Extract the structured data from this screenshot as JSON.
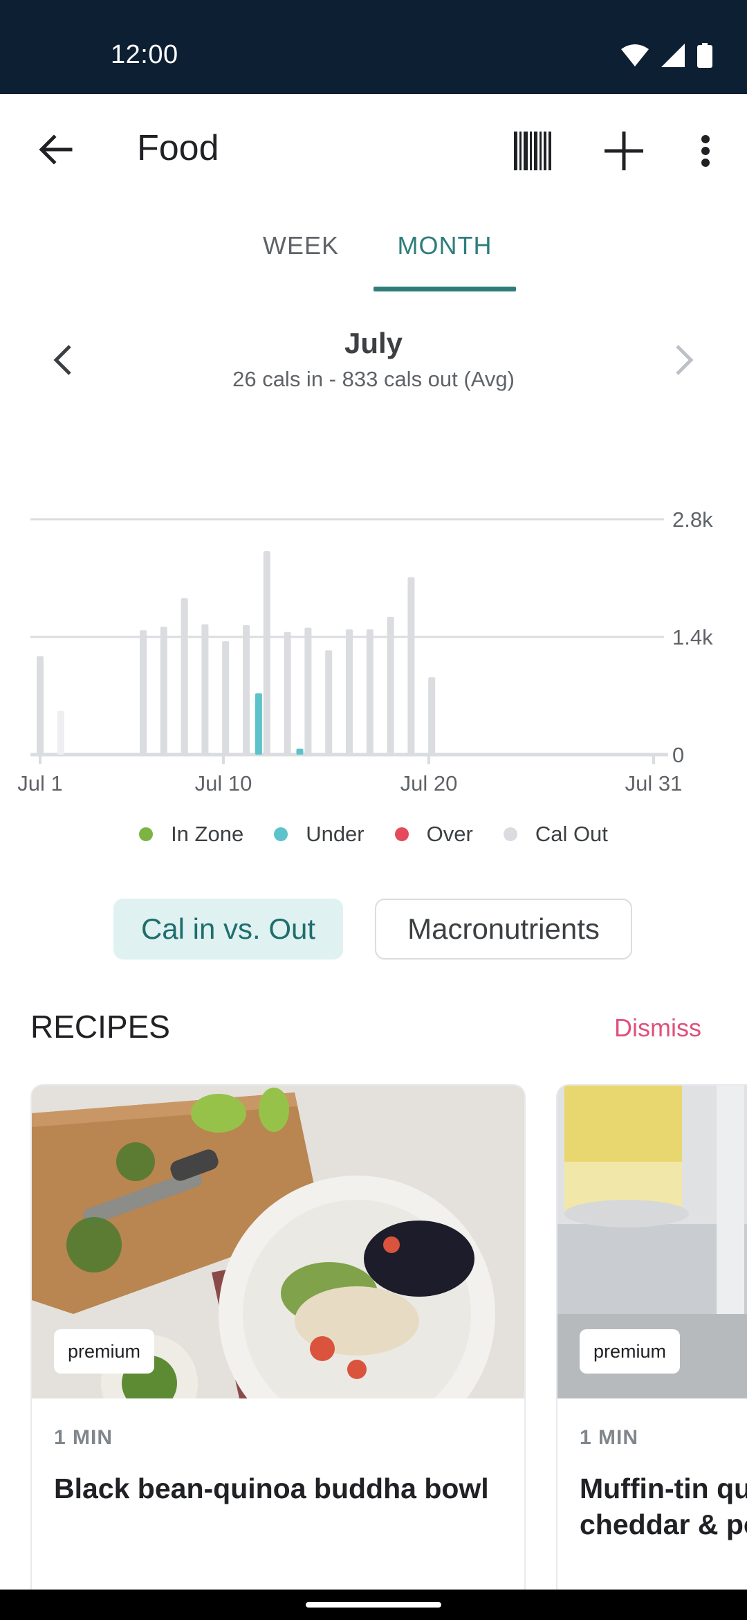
{
  "status_bar": {
    "time": "12:00"
  },
  "app_bar": {
    "title": "Food",
    "icons": [
      "arrow-back-icon",
      "barcode-icon",
      "plus-icon",
      "more-vert-icon"
    ]
  },
  "tabs": {
    "week": "WEEK",
    "month": "MONTH",
    "selected": "MONTH"
  },
  "period": {
    "title": "July",
    "subtitle": "26 cals in - 833 cals out (Avg)"
  },
  "chart_data": {
    "type": "bar",
    "x_ticks": [
      "Jul 1",
      "Jul 10",
      "Jul 20",
      "Jul 31"
    ],
    "y_ticks": [
      "2.8k",
      "1.4k",
      "0"
    ],
    "ylim": [
      0,
      2800
    ],
    "series": [
      {
        "name": "Cal Out",
        "color": "#dadce0",
        "points": [
          {
            "day": 1,
            "value": 1170
          },
          {
            "day": 2,
            "value": 520
          },
          {
            "day": 6,
            "value": 1480
          },
          {
            "day": 7,
            "value": 1520
          },
          {
            "day": 8,
            "value": 1860
          },
          {
            "day": 9,
            "value": 1550
          },
          {
            "day": 10,
            "value": 1350
          },
          {
            "day": 11,
            "value": 1540
          },
          {
            "day": 12,
            "value": 2420
          },
          {
            "day": 13,
            "value": 1460
          },
          {
            "day": 14,
            "value": 1510
          },
          {
            "day": 15,
            "value": 1240
          },
          {
            "day": 16,
            "value": 1490
          },
          {
            "day": 17,
            "value": 1490
          },
          {
            "day": 18,
            "value": 1640
          },
          {
            "day": 19,
            "value": 2110
          },
          {
            "day": 20,
            "value": 920
          }
        ]
      },
      {
        "name": "Under",
        "color": "#5bc3c9",
        "points": [
          {
            "day": 11.6,
            "value": 730
          },
          {
            "day": 13.6,
            "value": 70
          }
        ]
      }
    ]
  },
  "legend": [
    {
      "label": "In Zone",
      "color": "#7cb342"
    },
    {
      "label": "Under",
      "color": "#5bc3c9"
    },
    {
      "label": "Over",
      "color": "#e5495c"
    },
    {
      "label": "Cal Out",
      "color": "#dadce0"
    }
  ],
  "chips": {
    "active": "Cal in vs. Out",
    "inactive": "Macronutrients"
  },
  "recipes": {
    "header": "RECIPES",
    "dismiss": "Dismiss",
    "cards": [
      {
        "badge": "premium",
        "duration": "1 MIN",
        "title": "Black bean-quinoa buddha bowl"
      },
      {
        "badge": "premium",
        "duration": "1 MIN",
        "title": "Muffin-tin qu\ncheddar & po"
      }
    ]
  }
}
